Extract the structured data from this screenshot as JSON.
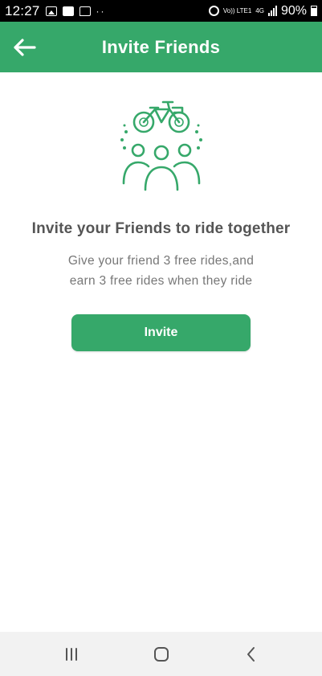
{
  "status_bar": {
    "time": "12:27",
    "dots": "··",
    "volte_tag": "Vo)) LTE1",
    "network_tag": "4G",
    "battery": "90%"
  },
  "app_bar": {
    "title": "Invite Friends",
    "back_icon": "arrow-left-icon"
  },
  "main": {
    "illustration_icon": "bicycle-friends-icon",
    "headline": "Invite your Friends to ride together",
    "subtext_line1": "Give your friend 3 free rides,and",
    "subtext_line2": "earn 3 free rides when they ride",
    "invite_label": "Invite"
  },
  "nav_bar": {
    "recents_icon": "recents-icon",
    "home_icon": "home-icon",
    "back_icon": "back-chevron-icon"
  },
  "colors": {
    "accent": "#36a86a",
    "headline_text": "#555555",
    "body_text": "#777777",
    "nav_background": "#f2f2f2"
  }
}
